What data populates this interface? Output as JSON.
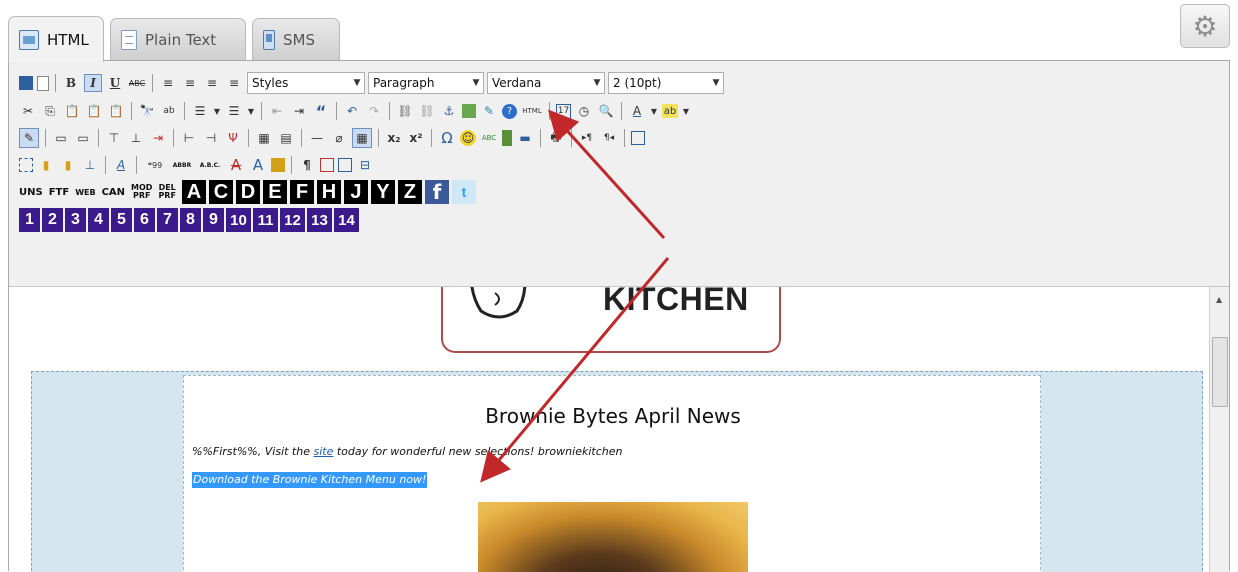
{
  "tabs": [
    {
      "label": "HTML",
      "active": true,
      "icon": "html-doc-icon"
    },
    {
      "label": "Plain Text",
      "active": false,
      "icon": "plain-text-doc-icon"
    },
    {
      "label": "SMS",
      "active": false,
      "icon": "sms-phone-icon"
    }
  ],
  "settings_icon": "gear-icon",
  "toolbar": {
    "styles_value": "Styles",
    "format_value": "Paragraph",
    "font_value": "Verdana",
    "size_value": "2 (10pt)",
    "html_source_label": "HTML",
    "merge_small_labels": [
      "UNS",
      "FTF",
      "WEB",
      "CAN"
    ],
    "merge_stacked_labels": [
      [
        "MOD",
        "PRF"
      ],
      [
        "DEL",
        "PRF"
      ]
    ],
    "letter_buttons": [
      "A",
      "C",
      "D",
      "E",
      "F",
      "H",
      "J",
      "Y",
      "Z"
    ],
    "number_buttons": [
      "1",
      "2",
      "3",
      "4",
      "5",
      "6",
      "7",
      "8",
      "9",
      "10",
      "11",
      "12",
      "13",
      "14"
    ],
    "quote_labels": [
      "ABBR",
      "A.B.C."
    ]
  },
  "content": {
    "logo_text": "KITCHEN",
    "news_title": "Brownie Bytes April News",
    "greeting_prefix": "%%First%%, Visit the ",
    "greeting_link": "site",
    "greeting_suffix": " today for wonderful new selections! browniekitchen",
    "selected_link_text": "Download the Brownie Kitchen Menu now!"
  },
  "colors": {
    "selection": "#3399ff",
    "number_buttons": "#3b1a8c",
    "annotation_arrow": "#c0282a",
    "band": "#d6e6ee"
  }
}
